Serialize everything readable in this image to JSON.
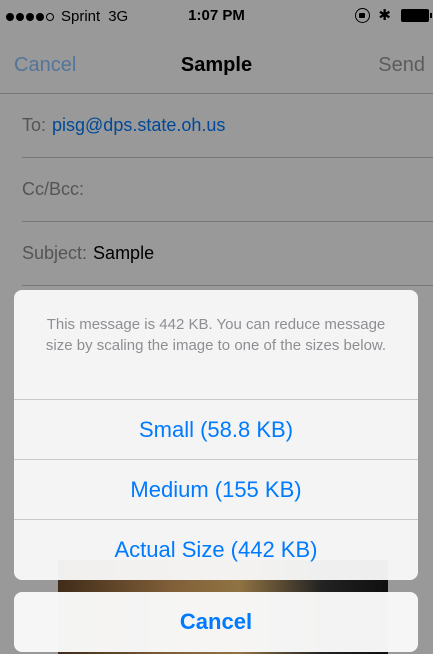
{
  "status_bar": {
    "carrier": "Sprint",
    "network": "3G",
    "time": "1:07 PM",
    "bluetooth_glyph": "✱"
  },
  "nav": {
    "cancel_label": "Cancel",
    "title": "Sample",
    "send_label": "Send"
  },
  "fields": {
    "to_label": "To:",
    "to_value": "pisg@dps.state.oh.us",
    "cc_label": "Cc/Bcc:",
    "subject_label": "Subject:",
    "subject_value": "Sample"
  },
  "action_sheet": {
    "message": "This message is 442 KB. You can reduce message size by scaling the image to one of the sizes below.",
    "options": [
      {
        "label": "Small (58.8 KB)"
      },
      {
        "label": "Medium (155 KB)"
      },
      {
        "label": "Actual Size (442 KB)"
      }
    ],
    "cancel_label": "Cancel"
  },
  "colors": {
    "accent": "#007aff",
    "separator": "#c8c7cc",
    "secondary_text": "#8e8e93"
  }
}
